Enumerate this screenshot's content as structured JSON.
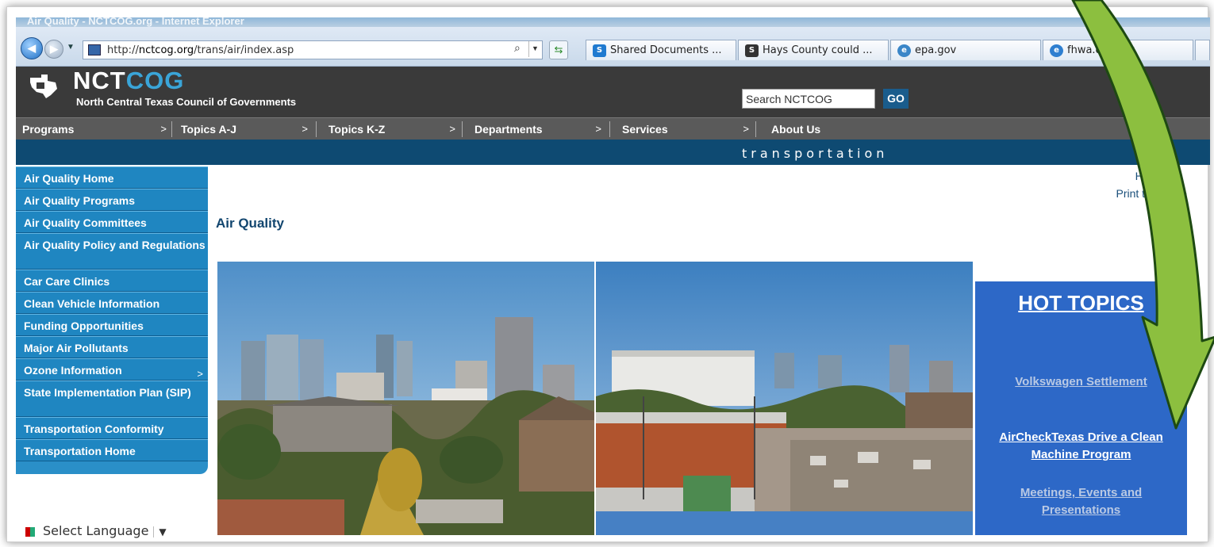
{
  "window": {
    "title": "Air Quality - NCTCOG.org - Internet Explorer"
  },
  "browser": {
    "url_prefix": "http://",
    "url_host": "nctcog.org",
    "url_path": "/trans/air/index.asp",
    "tabs": [
      {
        "label": "Shared Documents ...",
        "icon": "sharepoint-icon",
        "color": "#1f7ad0"
      },
      {
        "label": "Hays County could ...",
        "icon": "s-logo-icon",
        "color": "#333333"
      },
      {
        "label": "epa.gov",
        "icon": "epa-icon",
        "color": "#3a86c8"
      },
      {
        "label": "fhwa.dot.gov",
        "icon": "ie-icon",
        "color": "#2f7fd0"
      }
    ]
  },
  "header": {
    "logo_prefix": "NCT",
    "logo_suffix": "COG",
    "logo_subtitle": "North Central Texas Council of Governments",
    "search_placeholder": "Search NCTCOG",
    "go_label": "GO"
  },
  "menu": [
    {
      "label": "Programs",
      "arrow": ">"
    },
    {
      "label": "Topics A-J",
      "arrow": ">"
    },
    {
      "label": "Topics K-Z",
      "arrow": ">"
    },
    {
      "label": "Departments",
      "arrow": ">"
    },
    {
      "label": "Services",
      "arrow": ">"
    },
    {
      "label": "About Us",
      "arrow": ""
    }
  ],
  "band_label": "transportation",
  "sidebar": [
    {
      "label": "Air Quality Home",
      "arrow": ""
    },
    {
      "label": "Air Quality Programs",
      "arrow": ""
    },
    {
      "label": "Air Quality Committees",
      "arrow": ""
    },
    {
      "label": "Air Quality Policy and Regulations",
      "arrow": ""
    },
    {
      "label": "Car Care Clinics",
      "arrow": ""
    },
    {
      "label": "Clean Vehicle Information",
      "arrow": ""
    },
    {
      "label": "Funding Opportunities",
      "arrow": ""
    },
    {
      "label": "Major Air Pollutants",
      "arrow": ""
    },
    {
      "label": "Ozone Information",
      "arrow": ">"
    },
    {
      "label": "State Implementation Plan (SIP)",
      "arrow": ""
    },
    {
      "label": "Transportation Conformity",
      "arrow": ""
    },
    {
      "label": "Transportation Home",
      "arrow": ""
    }
  ],
  "language": {
    "label": "Select Language",
    "arrow": "▼"
  },
  "main": {
    "home_link": "Home",
    "print_link": "Print this page",
    "page_title": "Air Quality"
  },
  "hot_topics": {
    "title": "HOT TOPICS",
    "links": [
      {
        "label": "Volkswagen Settlement",
        "color": "#b9c9e4"
      },
      {
        "label": "AirCheckTexas Drive a Clean Machine Program",
        "color": "#ffffff"
      },
      {
        "label": "Meetings, Events and Presentations",
        "color": "#b9c9e4"
      }
    ]
  },
  "colors": {
    "accent_green": "#8cbf3f",
    "menu_dark": "#3a3a3a",
    "nav_blue": "#1f86c1",
    "band_blue": "#0e4a72",
    "hot_blue": "#2d68c7"
  }
}
